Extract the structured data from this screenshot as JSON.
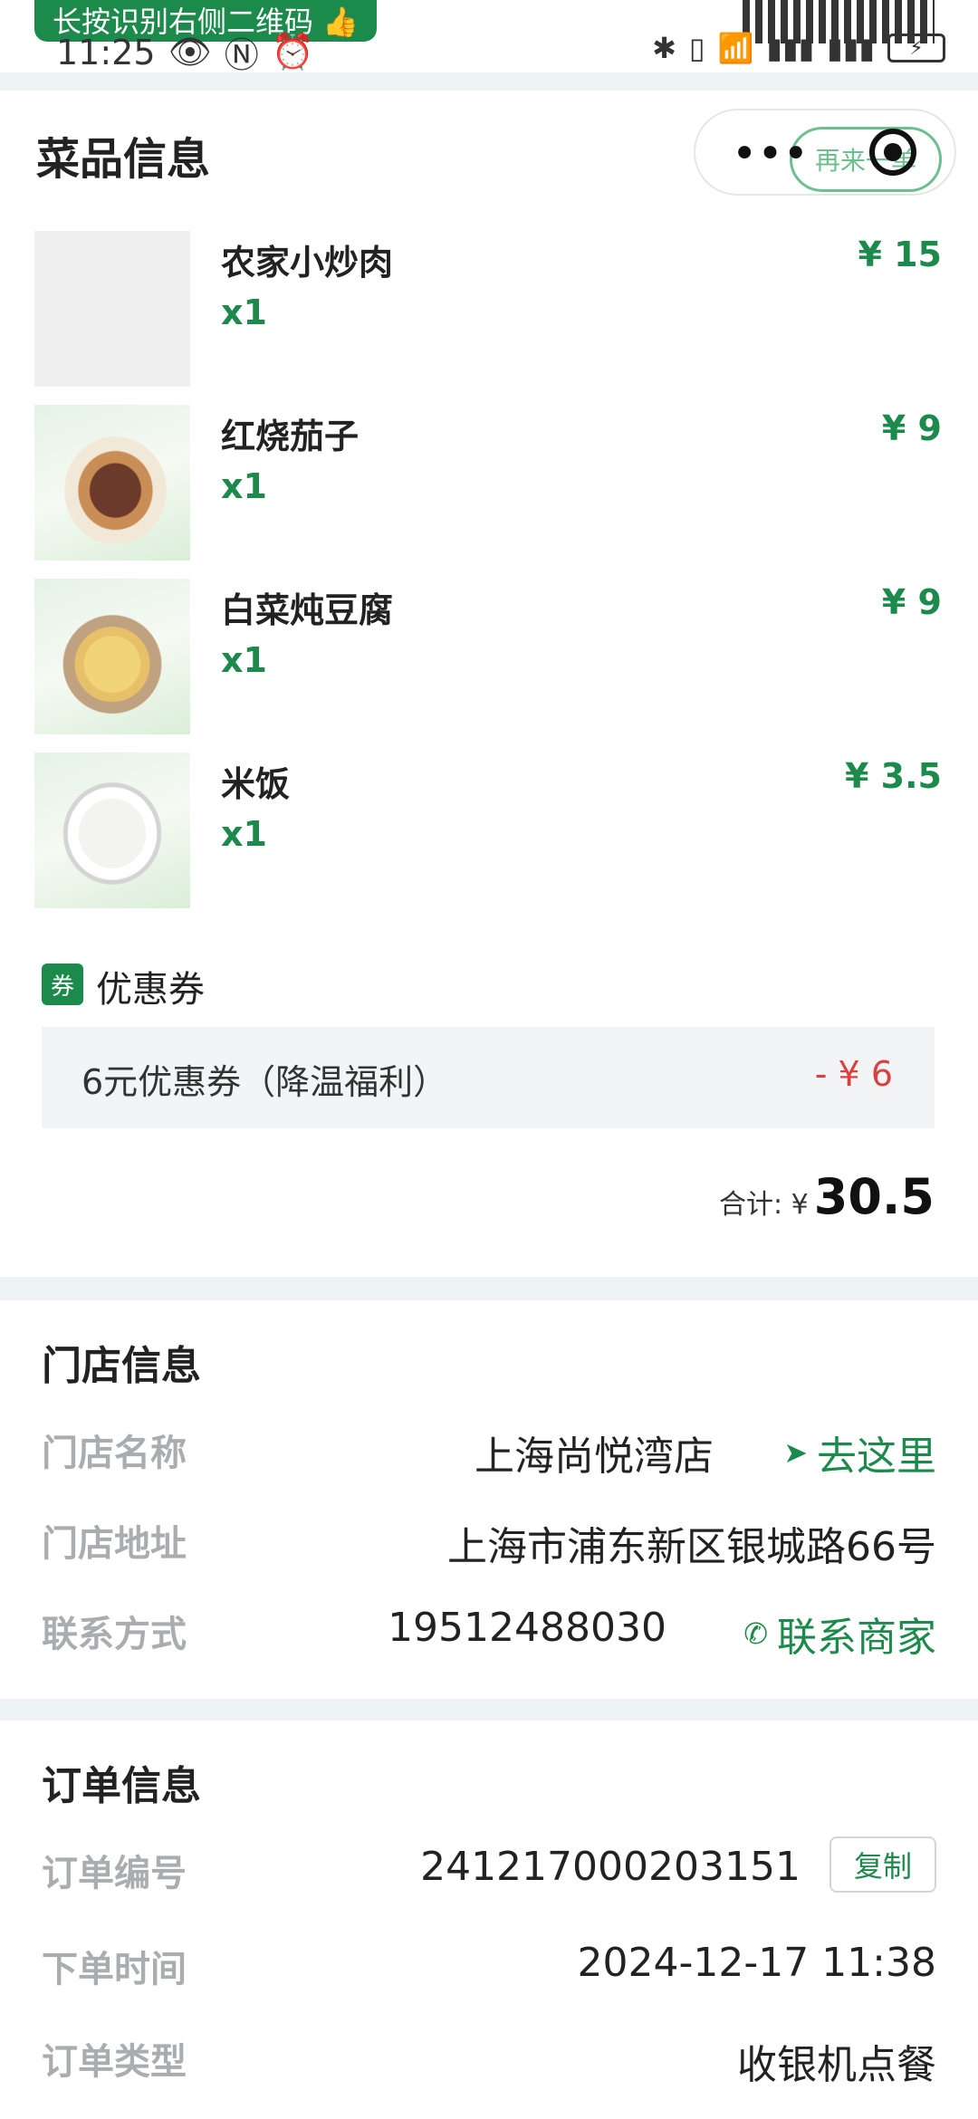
{
  "status_bar": {
    "qr_banner": "长按识别右侧二维码",
    "time": "11:25"
  },
  "dishes_section": {
    "title": "菜品信息",
    "reorder_label": "再来一单",
    "items": [
      {
        "name": "农家小炒肉",
        "qty": "x1",
        "price": "¥ 15"
      },
      {
        "name": "红烧茄子",
        "qty": "x1",
        "price": "¥ 9"
      },
      {
        "name": "白菜炖豆腐",
        "qty": "x1",
        "price": "¥ 9"
      },
      {
        "name": "米饭",
        "qty": "x1",
        "price": "¥ 3.5"
      }
    ],
    "coupon": {
      "tag": "券",
      "title": "优惠券",
      "name": "6元优惠券（降温福利）",
      "amount": "- ¥ 6"
    },
    "total": {
      "label": "合计: ¥",
      "value": "30.5"
    }
  },
  "store_section": {
    "title": "门店信息",
    "rows": [
      {
        "label": "门店名称",
        "value": "上海尚悦湾店",
        "action": "去这里"
      },
      {
        "label": "门店地址",
        "value": "上海市浦东新区银城路66号"
      },
      {
        "label": "联系方式",
        "value": "19512488030",
        "action": "联系商家"
      }
    ]
  },
  "order_section": {
    "title": "订单信息",
    "rows": [
      {
        "label": "订单编号",
        "value": "241217000203151",
        "action": "复制"
      },
      {
        "label": "下单时间",
        "value": "2024-12-17 11:38"
      },
      {
        "label": "订单类型",
        "value": "收银机点餐"
      }
    ]
  },
  "colors": {
    "accent": "#1c8a4b",
    "discount": "#d94141",
    "label_gray": "#a9adb0"
  }
}
